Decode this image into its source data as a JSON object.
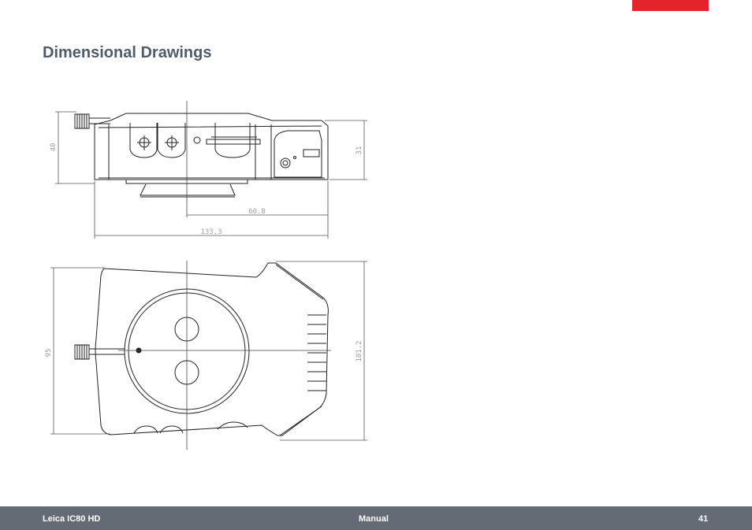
{
  "page": {
    "title": "Dimensional Drawings",
    "accent_color": "#e2242c",
    "footer_color": "#646b74"
  },
  "drawing": {
    "side_view": {
      "dim_height_left": "40",
      "dim_height_right": "31",
      "dim_width_partial": "60.8",
      "dim_width_total": "133.3"
    },
    "top_view": {
      "dim_height_left": "95",
      "dim_height_right": "101.2"
    }
  },
  "footer": {
    "product": "Leica IC80 HD",
    "section": "Manual",
    "page_number": "41"
  }
}
